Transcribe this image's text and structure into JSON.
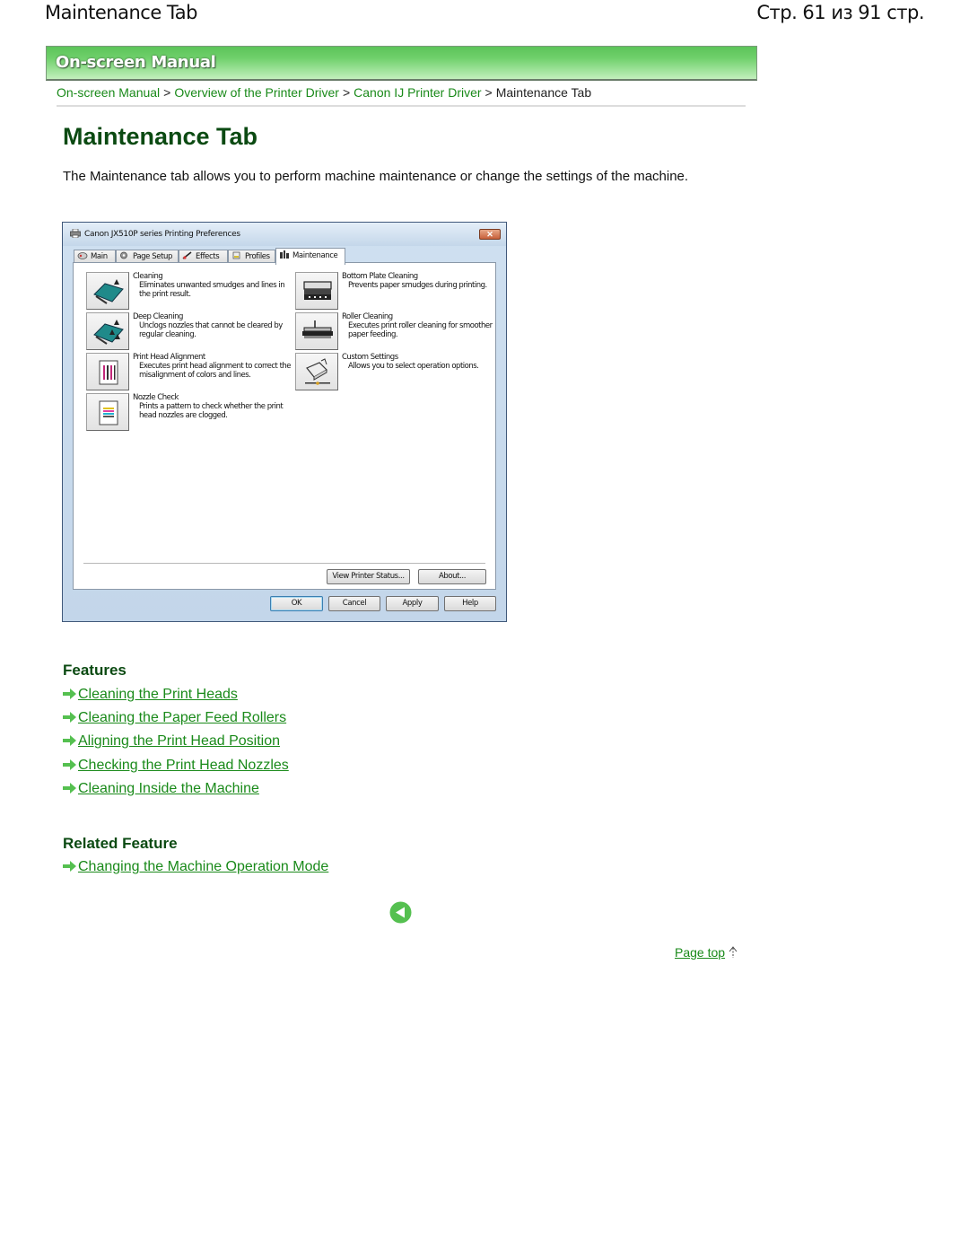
{
  "document": {
    "title": "Maintenance Tab",
    "page_counter": "Стр. 61 из 91 стр."
  },
  "banner": {
    "title": "On-screen Manual"
  },
  "breadcrumb": {
    "links": [
      "On-screen Manual",
      "Overview of the Printer Driver",
      "Canon IJ Printer Driver"
    ],
    "separator": ">",
    "current": "Maintenance Tab"
  },
  "main": {
    "heading": "Maintenance Tab",
    "intro": "The Maintenance tab allows you to perform machine maintenance or change the settings of the machine."
  },
  "dialog": {
    "title": "Canon JX510P series Printing Preferences",
    "close_glyph": "✕",
    "tabs": [
      {
        "label": "Main",
        "icon": "main-tab-icon",
        "active": false
      },
      {
        "label": "Page Setup",
        "icon": "page-setup-tab-icon",
        "active": false
      },
      {
        "label": "Effects",
        "icon": "effects-tab-icon",
        "active": false
      },
      {
        "label": "Profiles",
        "icon": "profiles-tab-icon",
        "active": false
      },
      {
        "label": "Maintenance",
        "icon": "maintenance-tab-icon",
        "active": true
      }
    ],
    "items": [
      {
        "title": "Cleaning",
        "desc": "Eliminates unwanted smudges and lines in the print result.",
        "icon": "cleaning-icon"
      },
      {
        "title": "Deep Cleaning",
        "desc": "Unclogs nozzles that cannot be cleared by regular cleaning.",
        "icon": "deep-cleaning-icon"
      },
      {
        "title": "Print Head Alignment",
        "desc": "Executes print head alignment to correct the misalignment of colors and lines.",
        "icon": "print-head-alignment-icon"
      },
      {
        "title": "Nozzle Check",
        "desc": "Prints a pattern to check whether the print head nozzles are clogged.",
        "icon": "nozzle-check-icon"
      },
      {
        "title": "Bottom Plate Cleaning",
        "desc": "Prevents paper smudges during printing.",
        "icon": "bottom-plate-cleaning-icon"
      },
      {
        "title": "Roller Cleaning",
        "desc": "Executes print roller cleaning for smoother paper feeding.",
        "icon": "roller-cleaning-icon"
      },
      {
        "title": "Custom Settings",
        "desc": "Allows you to select operation options.",
        "icon": "custom-settings-icon"
      }
    ],
    "buttons": {
      "view_printer_status": "View Printer Status...",
      "about": "About...",
      "ok": "OK",
      "cancel": "Cancel",
      "apply": "Apply",
      "help": "Help"
    }
  },
  "features": {
    "heading": "Features",
    "links": [
      "Cleaning the Print Heads",
      "Cleaning the Paper Feed Rollers",
      "Aligning the Print Head Position",
      "Checking the Print Head Nozzles",
      "Cleaning Inside the Machine"
    ]
  },
  "related": {
    "heading": "Related Feature",
    "links": [
      "Changing the Machine Operation Mode"
    ]
  },
  "navigation": {
    "back_icon": "back-arrow-icon",
    "page_top": "Page top"
  },
  "colors": {
    "link": "#1a8a1a",
    "heading": "#0b4a12",
    "banner": "#6fd06b"
  }
}
